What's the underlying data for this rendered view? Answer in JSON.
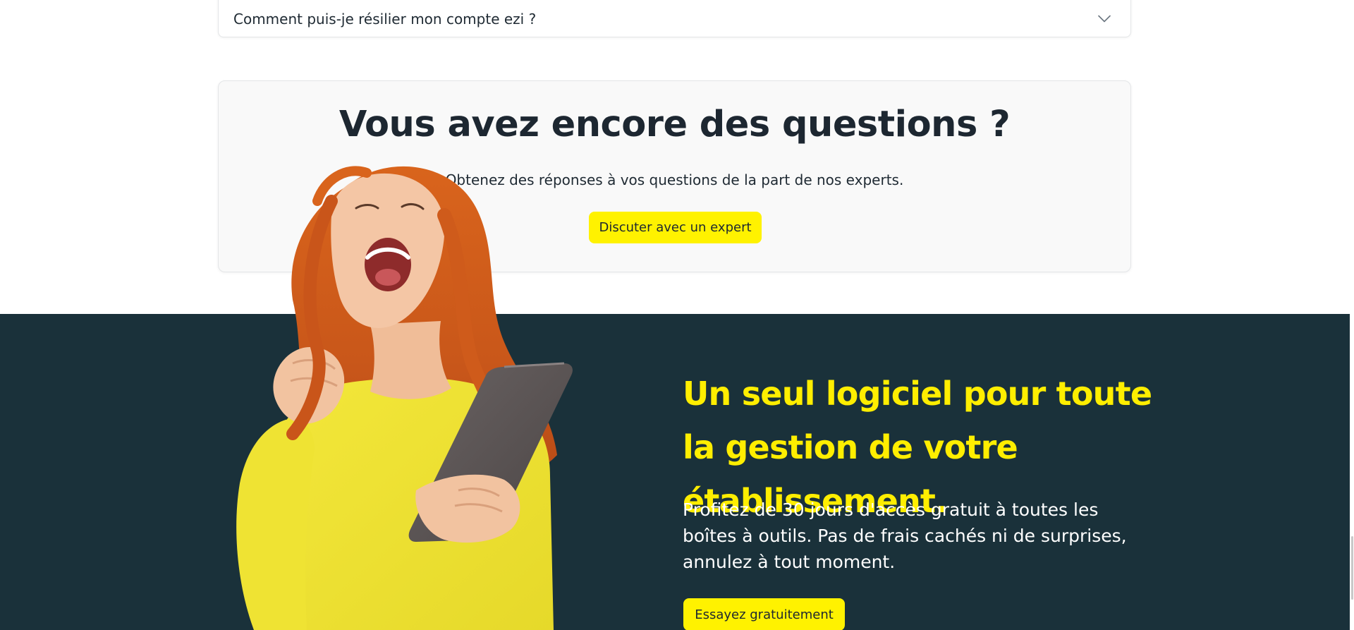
{
  "faq": {
    "question": "Comment puis-je résilier mon compte ezi ?",
    "toggle_icon": "chevron-down-icon"
  },
  "questions_card": {
    "title": "Vous avez encore des questions ?",
    "subtitle": "Obtenez des réponses à vos questions de la part de nos experts.",
    "button_label": "Discuter avec un expert"
  },
  "promo": {
    "title": "Un seul logiciel pour toute la gestion de votre établissement.",
    "text": "Profitez de 30 jours d'accès gratuit à toutes les boîtes à outils. Pas de frais cachés ni de surprises, annulez à tout moment.",
    "button_label": "Essayez gratuitement",
    "illustration": "woman-celebrating-with-tablet"
  },
  "colors": {
    "accent_yellow": "#fff200",
    "title_yellow": "#ffee00",
    "dark_band": "#1a313a",
    "card_background": "#f9f9f9",
    "text_dark": "#1d2731"
  }
}
